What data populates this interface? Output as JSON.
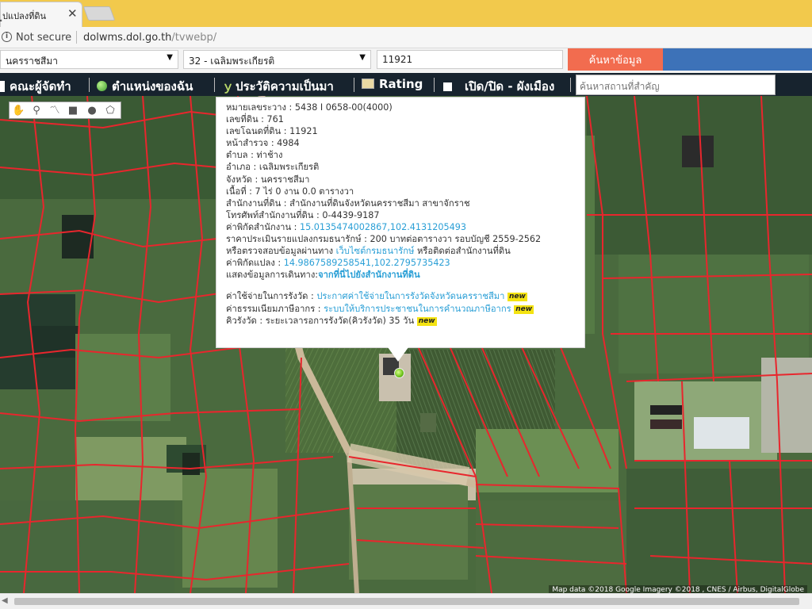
{
  "browser": {
    "tab_title": "ูปแปลงที่ดิน",
    "close_glyph": "✕",
    "not_secure": "Not secure",
    "url_host": "dolwms.dol.go.th",
    "url_path": "/tvwebp/"
  },
  "search": {
    "province": "นครราชสีมา",
    "district": "32 - เฉลิมพระเกียรติ",
    "parcel_no": "11921",
    "submit_label": "ค้นหาข้อมูล"
  },
  "nav": {
    "items": [
      {
        "label": "คณะผู้จัดทำ",
        "icon": "people-icon"
      },
      {
        "label": "ตำแหน่งของฉัน",
        "icon": "globe-icon"
      },
      {
        "label": "ประวัติความเป็นมา",
        "icon": "sprout-icon"
      },
      {
        "label": "Rating",
        "icon": "chart-icon"
      },
      {
        "label": "เปิด/ปิด - ผังเมือง",
        "icon": "checkbox-icon"
      }
    ],
    "place_search_placeholder": "ค้นหาสถานที่สำคัญ"
  },
  "draw_tools": [
    "hand-icon",
    "pin-icon",
    "polyline-icon",
    "rectangle-icon",
    "circle-icon",
    "polygon-icon"
  ],
  "popup": {
    "rows": [
      {
        "label": "หมายเลขระวาง",
        "value": "5438 I 0658-00(4000)"
      },
      {
        "label": "เลขที่ดิน",
        "value": "761"
      },
      {
        "label": "เลขโฉนดที่ดิน",
        "value": "11921"
      },
      {
        "label": "หน้าสำรวจ",
        "value": "4984"
      },
      {
        "label": "ตำบล",
        "value": "ท่าช้าง"
      },
      {
        "label": "อำเภอ",
        "value": "เฉลิมพระเกียรติ"
      },
      {
        "label": "จังหวัด",
        "value": "นครราชสีมา"
      },
      {
        "label": "เนื้อที่",
        "value": "7 ไร่ 0 งาน 0.0 ตารางวา"
      },
      {
        "label": "สำนักงานที่ดิน",
        "value": "สำนักงานที่ดินจังหวัดนครราชสีมา สาขาจักราช"
      },
      {
        "label": "โทรศัพท์สำนักงานที่ดิน",
        "value": "0-4439-9187"
      },
      {
        "label": "ค่าพิกัดสำนักงาน",
        "value": "15.0135474002867,102.4131205493"
      },
      {
        "label": "ราคาประเมินรายแปลงกรมธนารักษ์",
        "value": "200 บาทต่อตารางวา รอบบัญชี 2559-2562"
      }
    ],
    "verify_prefix": "หรือตรวจสอบข้อมูลผ่านทาง",
    "verify_link": "เว็บไซต์กรมธนารักษ์",
    "verify_suffix": "หรือติดต่อสำนักงานที่ดิน",
    "parcel_coord_label": "ค่าพิกัดแปลง",
    "parcel_coord_value": "14.9867589258541,102.2795735423",
    "route_label": "แสดงข้อมูลการเดินทาง:",
    "route_link": "จากที่นี่ไปยังสำนักงานที่ดิน",
    "survey_cost_label": "ค่าใช้จ่ายในการรังวัด",
    "survey_cost_link": "ประกาศค่าใช้จ่ายในการรังวัดจังหวัดนครราชสีมา",
    "fee_label": "ค่าธรรมเนียมภาษีอากร",
    "fee_link": "ระบบให้บริการประชาชนในการคำนวณภาษีอากร",
    "queue_label": "คิวรังวัด",
    "queue_value": "ระยะเวลารอการรังวัด(คิวรังวัด) 35 วัน",
    "new_badge": "new"
  },
  "attribution": "Map data ©2018 Google Imagery ©2018 , CNES / Airbus, DigitalGlobe",
  "colors": {
    "parcel_line": "#e8262d",
    "nav_bg": "#17232e",
    "link": "#2a9fd6",
    "search_button": "#f26c4f",
    "badge": "#f4e312"
  }
}
